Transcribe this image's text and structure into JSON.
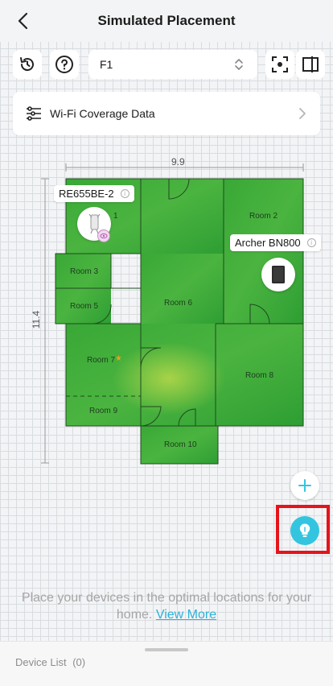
{
  "header": {
    "title": "Simulated Placement"
  },
  "toolbar": {
    "floor_value": "F1"
  },
  "coverage": {
    "label": "Wi-Fi Coverage Data"
  },
  "floorplan": {
    "width_label": "9.9",
    "height_label": "11.4",
    "rooms": {
      "room1": "1",
      "room2": "Room 2",
      "room3": "Room 3",
      "room5": "Room 5",
      "room6": "Room 6",
      "room7": "Room 7",
      "room8": "Room 8",
      "room9": "Room 9",
      "room10": "Room 10"
    },
    "devices": [
      {
        "name": "RE655BE-2",
        "icon": "extender-icon"
      },
      {
        "name": "Archer BN800",
        "icon": "router-icon"
      }
    ]
  },
  "hint": {
    "text": "Place your devices in the optimal locations for your home.",
    "link": "View More"
  },
  "bottom": {
    "device_list_label": "Device List",
    "device_count": "(0)"
  },
  "colors": {
    "accent": "#33c5e0",
    "highlight": "#e4141c",
    "coverage_green": "#3fae3c"
  }
}
